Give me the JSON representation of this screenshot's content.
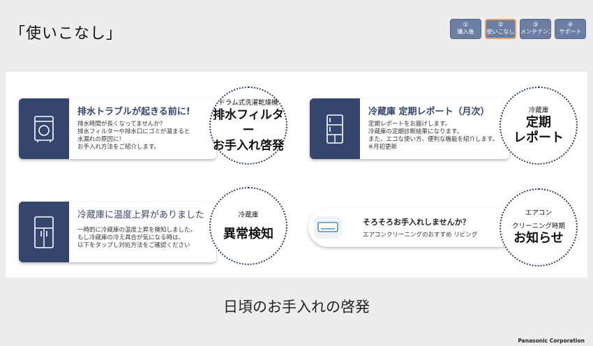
{
  "page": {
    "title": "「使いこなし」",
    "caption": "日頃のお手入れの啓発",
    "footer": "Panasonic Corporation"
  },
  "steps": [
    {
      "num": "①",
      "label": "購入後"
    },
    {
      "num": "②",
      "label": "使いこなし",
      "active": true
    },
    {
      "num": "③",
      "label": "メンテナンス"
    },
    {
      "num": "④",
      "label": "サポート"
    }
  ],
  "cards": {
    "washer": {
      "heading": "排水トラブルが起きる前に!",
      "lines": [
        "排水時間が長くなってませんか？",
        "排水フィルターや排水口にゴミが溜まると",
        "水漏れの原因に!",
        "お手入れ方法をご紹介します。"
      ],
      "circle_small": "ドラム式洗濯乾燥機",
      "circle_big1": "排水フィルター",
      "circle_big2": "お手入れ啓発",
      "icon": "washing-machine-icon"
    },
    "fridge_report": {
      "heading": "冷蔵庫 定期レポート（月次）",
      "lines": [
        "定期レポートをお届けします。",
        "冷蔵庫の定期診断結果になります。",
        "また、エコな使い方、便利な機能を紹介します。",
        "※月初更新"
      ],
      "circle_small": "冷蔵庫",
      "circle_big1": "定期",
      "circle_big2": "レポート",
      "icon": "refrigerator-icon"
    },
    "fridge_alert": {
      "heading": "冷蔵庫に温度上昇がありました",
      "lines": [
        "一時的に冷蔵庫の温度上昇を検知しました。",
        "もし冷蔵庫の冷え具合が気になる時は、",
        "以下をタップし対処方法をご確認ください"
      ],
      "circle_small": "冷蔵庫",
      "circle_big1": "異常検知",
      "icon": "refrigerator-icon"
    },
    "aircon": {
      "title": "そろそろお手入れしませんか？",
      "sub": "エアコンクリーニングのおすすめ",
      "location": "リビング",
      "circle_small1": "エアコン",
      "circle_small2": "クリーニング時期",
      "circle_big1": "お知らせ",
      "icon": "air-conditioner-icon"
    }
  },
  "colors": {
    "navy": "#34466d",
    "step_blue": "#6a7fa3",
    "active_border": "#e8a06a"
  }
}
